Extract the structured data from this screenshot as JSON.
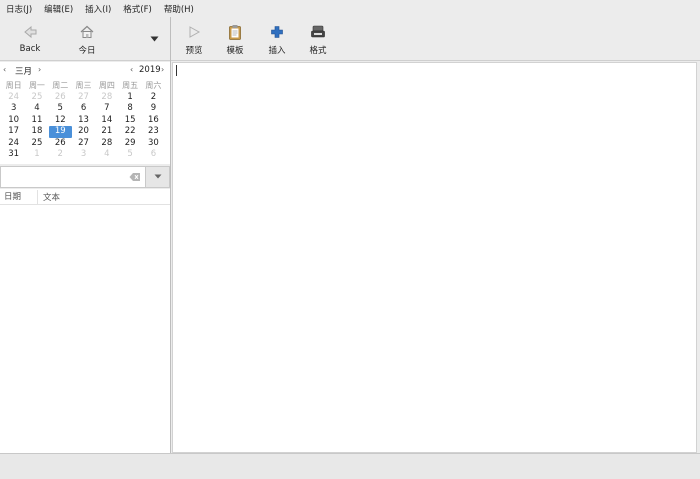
{
  "menubar": {
    "items": [
      "日志(J)",
      "编辑(E)",
      "插入(I)",
      "格式(F)",
      "帮助(H)"
    ]
  },
  "toolbar_left": {
    "back_label": "Back",
    "today_label": "今日"
  },
  "toolbar_right": {
    "preview_label": "预览",
    "template_label": "模板",
    "insert_label": "插入",
    "format_label": "格式"
  },
  "calendar": {
    "month": "三月",
    "year": "2019",
    "weekdays": [
      "周日",
      "周一",
      "周二",
      "周三",
      "周四",
      "周五",
      "周六"
    ],
    "weeks": [
      [
        {
          "d": "24",
          "o": true
        },
        {
          "d": "25",
          "o": true
        },
        {
          "d": "26",
          "o": true
        },
        {
          "d": "27",
          "o": true
        },
        {
          "d": "28",
          "o": true
        },
        {
          "d": "1",
          "o": false
        },
        {
          "d": "2",
          "o": false
        }
      ],
      [
        {
          "d": "3",
          "o": false
        },
        {
          "d": "4",
          "o": false
        },
        {
          "d": "5",
          "o": false
        },
        {
          "d": "6",
          "o": false
        },
        {
          "d": "7",
          "o": false
        },
        {
          "d": "8",
          "o": false
        },
        {
          "d": "9",
          "o": false
        }
      ],
      [
        {
          "d": "10",
          "o": false
        },
        {
          "d": "11",
          "o": false
        },
        {
          "d": "12",
          "o": false
        },
        {
          "d": "13",
          "o": false
        },
        {
          "d": "14",
          "o": false
        },
        {
          "d": "15",
          "o": false
        },
        {
          "d": "16",
          "o": false
        }
      ],
      [
        {
          "d": "17",
          "o": false
        },
        {
          "d": "18",
          "o": false
        },
        {
          "d": "19",
          "o": false,
          "sel": true
        },
        {
          "d": "20",
          "o": false
        },
        {
          "d": "21",
          "o": false
        },
        {
          "d": "22",
          "o": false
        },
        {
          "d": "23",
          "o": false
        }
      ],
      [
        {
          "d": "24",
          "o": false
        },
        {
          "d": "25",
          "o": false
        },
        {
          "d": "26",
          "o": false
        },
        {
          "d": "27",
          "o": false
        },
        {
          "d": "28",
          "o": false
        },
        {
          "d": "29",
          "o": false
        },
        {
          "d": "30",
          "o": false
        }
      ],
      [
        {
          "d": "31",
          "o": false
        },
        {
          "d": "1",
          "o": true
        },
        {
          "d": "2",
          "o": true
        },
        {
          "d": "3",
          "o": true
        },
        {
          "d": "4",
          "o": true
        },
        {
          "d": "5",
          "o": true
        },
        {
          "d": "6",
          "o": true
        }
      ]
    ]
  },
  "search": {
    "value": "",
    "placeholder": ""
  },
  "list": {
    "col_date": "日期",
    "col_text": "文本"
  },
  "colors": {
    "selected_day": "#4a90d9",
    "insert_icon": "#2f6fbf"
  }
}
